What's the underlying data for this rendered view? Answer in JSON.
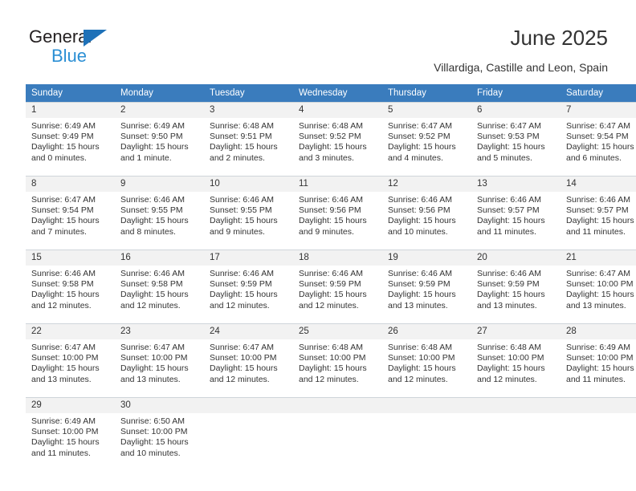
{
  "brand": {
    "name_top": "General",
    "name_bottom": "Blue",
    "triangle_color": "#1e71b8",
    "blue_text_color": "#2b8fd4"
  },
  "header": {
    "title": "June 2025",
    "subtitle": "Villardiga, Castille and Leon, Spain",
    "header_bg": "#3a7cbd",
    "daynum_bg": "#f2f2f2"
  },
  "weekday_headers": [
    "Sunday",
    "Monday",
    "Tuesday",
    "Wednesday",
    "Thursday",
    "Friday",
    "Saturday"
  ],
  "labels": {
    "sunrise_prefix": "Sunrise:",
    "sunset_prefix": "Sunset:",
    "daylight_prefix": "Daylight:"
  },
  "weeks": [
    [
      {
        "day": "1",
        "sunrise": "Sunrise: 6:49 AM",
        "sunset": "Sunset: 9:49 PM",
        "daylight_line1": "Daylight: 15 hours",
        "daylight_line2": "and 0 minutes."
      },
      {
        "day": "2",
        "sunrise": "Sunrise: 6:49 AM",
        "sunset": "Sunset: 9:50 PM",
        "daylight_line1": "Daylight: 15 hours",
        "daylight_line2": "and 1 minute."
      },
      {
        "day": "3",
        "sunrise": "Sunrise: 6:48 AM",
        "sunset": "Sunset: 9:51 PM",
        "daylight_line1": "Daylight: 15 hours",
        "daylight_line2": "and 2 minutes."
      },
      {
        "day": "4",
        "sunrise": "Sunrise: 6:48 AM",
        "sunset": "Sunset: 9:52 PM",
        "daylight_line1": "Daylight: 15 hours",
        "daylight_line2": "and 3 minutes."
      },
      {
        "day": "5",
        "sunrise": "Sunrise: 6:47 AM",
        "sunset": "Sunset: 9:52 PM",
        "daylight_line1": "Daylight: 15 hours",
        "daylight_line2": "and 4 minutes."
      },
      {
        "day": "6",
        "sunrise": "Sunrise: 6:47 AM",
        "sunset": "Sunset: 9:53 PM",
        "daylight_line1": "Daylight: 15 hours",
        "daylight_line2": "and 5 minutes."
      },
      {
        "day": "7",
        "sunrise": "Sunrise: 6:47 AM",
        "sunset": "Sunset: 9:54 PM",
        "daylight_line1": "Daylight: 15 hours",
        "daylight_line2": "and 6 minutes."
      }
    ],
    [
      {
        "day": "8",
        "sunrise": "Sunrise: 6:47 AM",
        "sunset": "Sunset: 9:54 PM",
        "daylight_line1": "Daylight: 15 hours",
        "daylight_line2": "and 7 minutes."
      },
      {
        "day": "9",
        "sunrise": "Sunrise: 6:46 AM",
        "sunset": "Sunset: 9:55 PM",
        "daylight_line1": "Daylight: 15 hours",
        "daylight_line2": "and 8 minutes."
      },
      {
        "day": "10",
        "sunrise": "Sunrise: 6:46 AM",
        "sunset": "Sunset: 9:55 PM",
        "daylight_line1": "Daylight: 15 hours",
        "daylight_line2": "and 9 minutes."
      },
      {
        "day": "11",
        "sunrise": "Sunrise: 6:46 AM",
        "sunset": "Sunset: 9:56 PM",
        "daylight_line1": "Daylight: 15 hours",
        "daylight_line2": "and 9 minutes."
      },
      {
        "day": "12",
        "sunrise": "Sunrise: 6:46 AM",
        "sunset": "Sunset: 9:56 PM",
        "daylight_line1": "Daylight: 15 hours",
        "daylight_line2": "and 10 minutes."
      },
      {
        "day": "13",
        "sunrise": "Sunrise: 6:46 AM",
        "sunset": "Sunset: 9:57 PM",
        "daylight_line1": "Daylight: 15 hours",
        "daylight_line2": "and 11 minutes."
      },
      {
        "day": "14",
        "sunrise": "Sunrise: 6:46 AM",
        "sunset": "Sunset: 9:57 PM",
        "daylight_line1": "Daylight: 15 hours",
        "daylight_line2": "and 11 minutes."
      }
    ],
    [
      {
        "day": "15",
        "sunrise": "Sunrise: 6:46 AM",
        "sunset": "Sunset: 9:58 PM",
        "daylight_line1": "Daylight: 15 hours",
        "daylight_line2": "and 12 minutes."
      },
      {
        "day": "16",
        "sunrise": "Sunrise: 6:46 AM",
        "sunset": "Sunset: 9:58 PM",
        "daylight_line1": "Daylight: 15 hours",
        "daylight_line2": "and 12 minutes."
      },
      {
        "day": "17",
        "sunrise": "Sunrise: 6:46 AM",
        "sunset": "Sunset: 9:59 PM",
        "daylight_line1": "Daylight: 15 hours",
        "daylight_line2": "and 12 minutes."
      },
      {
        "day": "18",
        "sunrise": "Sunrise: 6:46 AM",
        "sunset": "Sunset: 9:59 PM",
        "daylight_line1": "Daylight: 15 hours",
        "daylight_line2": "and 12 minutes."
      },
      {
        "day": "19",
        "sunrise": "Sunrise: 6:46 AM",
        "sunset": "Sunset: 9:59 PM",
        "daylight_line1": "Daylight: 15 hours",
        "daylight_line2": "and 13 minutes."
      },
      {
        "day": "20",
        "sunrise": "Sunrise: 6:46 AM",
        "sunset": "Sunset: 9:59 PM",
        "daylight_line1": "Daylight: 15 hours",
        "daylight_line2": "and 13 minutes."
      },
      {
        "day": "21",
        "sunrise": "Sunrise: 6:47 AM",
        "sunset": "Sunset: 10:00 PM",
        "daylight_line1": "Daylight: 15 hours",
        "daylight_line2": "and 13 minutes."
      }
    ],
    [
      {
        "day": "22",
        "sunrise": "Sunrise: 6:47 AM",
        "sunset": "Sunset: 10:00 PM",
        "daylight_line1": "Daylight: 15 hours",
        "daylight_line2": "and 13 minutes."
      },
      {
        "day": "23",
        "sunrise": "Sunrise: 6:47 AM",
        "sunset": "Sunset: 10:00 PM",
        "daylight_line1": "Daylight: 15 hours",
        "daylight_line2": "and 13 minutes."
      },
      {
        "day": "24",
        "sunrise": "Sunrise: 6:47 AM",
        "sunset": "Sunset: 10:00 PM",
        "daylight_line1": "Daylight: 15 hours",
        "daylight_line2": "and 12 minutes."
      },
      {
        "day": "25",
        "sunrise": "Sunrise: 6:48 AM",
        "sunset": "Sunset: 10:00 PM",
        "daylight_line1": "Daylight: 15 hours",
        "daylight_line2": "and 12 minutes."
      },
      {
        "day": "26",
        "sunrise": "Sunrise: 6:48 AM",
        "sunset": "Sunset: 10:00 PM",
        "daylight_line1": "Daylight: 15 hours",
        "daylight_line2": "and 12 minutes."
      },
      {
        "day": "27",
        "sunrise": "Sunrise: 6:48 AM",
        "sunset": "Sunset: 10:00 PM",
        "daylight_line1": "Daylight: 15 hours",
        "daylight_line2": "and 12 minutes."
      },
      {
        "day": "28",
        "sunrise": "Sunrise: 6:49 AM",
        "sunset": "Sunset: 10:00 PM",
        "daylight_line1": "Daylight: 15 hours",
        "daylight_line2": "and 11 minutes."
      }
    ],
    [
      {
        "day": "29",
        "sunrise": "Sunrise: 6:49 AM",
        "sunset": "Sunset: 10:00 PM",
        "daylight_line1": "Daylight: 15 hours",
        "daylight_line2": "and 11 minutes."
      },
      {
        "day": "30",
        "sunrise": "Sunrise: 6:50 AM",
        "sunset": "Sunset: 10:00 PM",
        "daylight_line1": "Daylight: 15 hours",
        "daylight_line2": "and 10 minutes."
      },
      {
        "day": "",
        "sunrise": "",
        "sunset": "",
        "daylight_line1": "",
        "daylight_line2": ""
      },
      {
        "day": "",
        "sunrise": "",
        "sunset": "",
        "daylight_line1": "",
        "daylight_line2": ""
      },
      {
        "day": "",
        "sunrise": "",
        "sunset": "",
        "daylight_line1": "",
        "daylight_line2": ""
      },
      {
        "day": "",
        "sunrise": "",
        "sunset": "",
        "daylight_line1": "",
        "daylight_line2": ""
      },
      {
        "day": "",
        "sunrise": "",
        "sunset": "",
        "daylight_line1": "",
        "daylight_line2": ""
      }
    ]
  ]
}
